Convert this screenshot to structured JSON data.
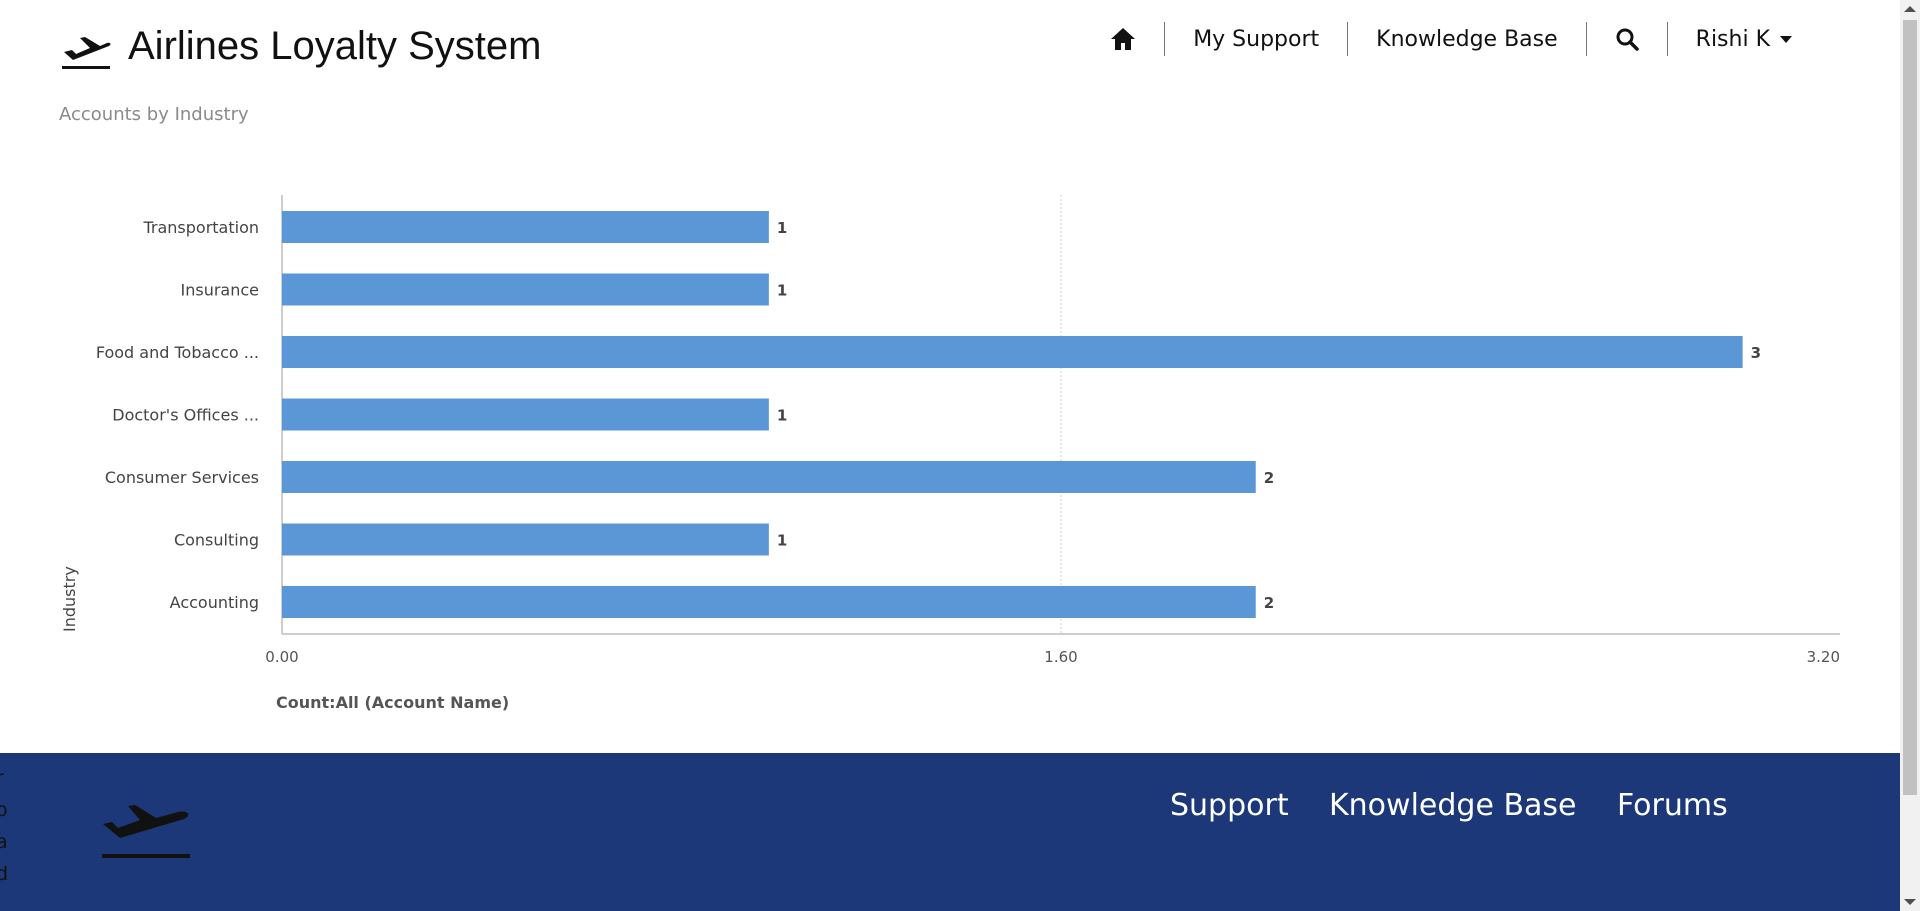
{
  "header": {
    "title": "Airlines Loyalty System",
    "nav": {
      "my_support": "My Support",
      "knowledge_base": "Knowledge Base",
      "user": "Rishi K"
    }
  },
  "page": {
    "subtitle": "Accounts by Industry"
  },
  "chart_data": {
    "type": "bar",
    "orientation": "horizontal",
    "categories": [
      "Transportation",
      "Insurance",
      "Food and Tobacco ...",
      "Doctor's Offices ...",
      "Consumer Services",
      "Consulting",
      "Accounting"
    ],
    "values": [
      1,
      1,
      3,
      1,
      2,
      1,
      2
    ],
    "xlim": [
      0,
      3.2
    ],
    "ticks": [
      "0.00",
      "1.60",
      "3.20"
    ],
    "xlabel": "Count:All (Account Name)",
    "ylabel": "Industry",
    "bar_color": "#5b97d6",
    "grid": true
  },
  "footer": {
    "links": [
      "Support",
      "Knowledge Base",
      "Forums"
    ],
    "background": "#1c3878",
    "edge_text": [
      "r",
      "o",
      "a",
      "d"
    ]
  },
  "icons": {
    "logo": "airplane-takeoff-icon",
    "home": "home-icon",
    "search": "search-icon"
  }
}
